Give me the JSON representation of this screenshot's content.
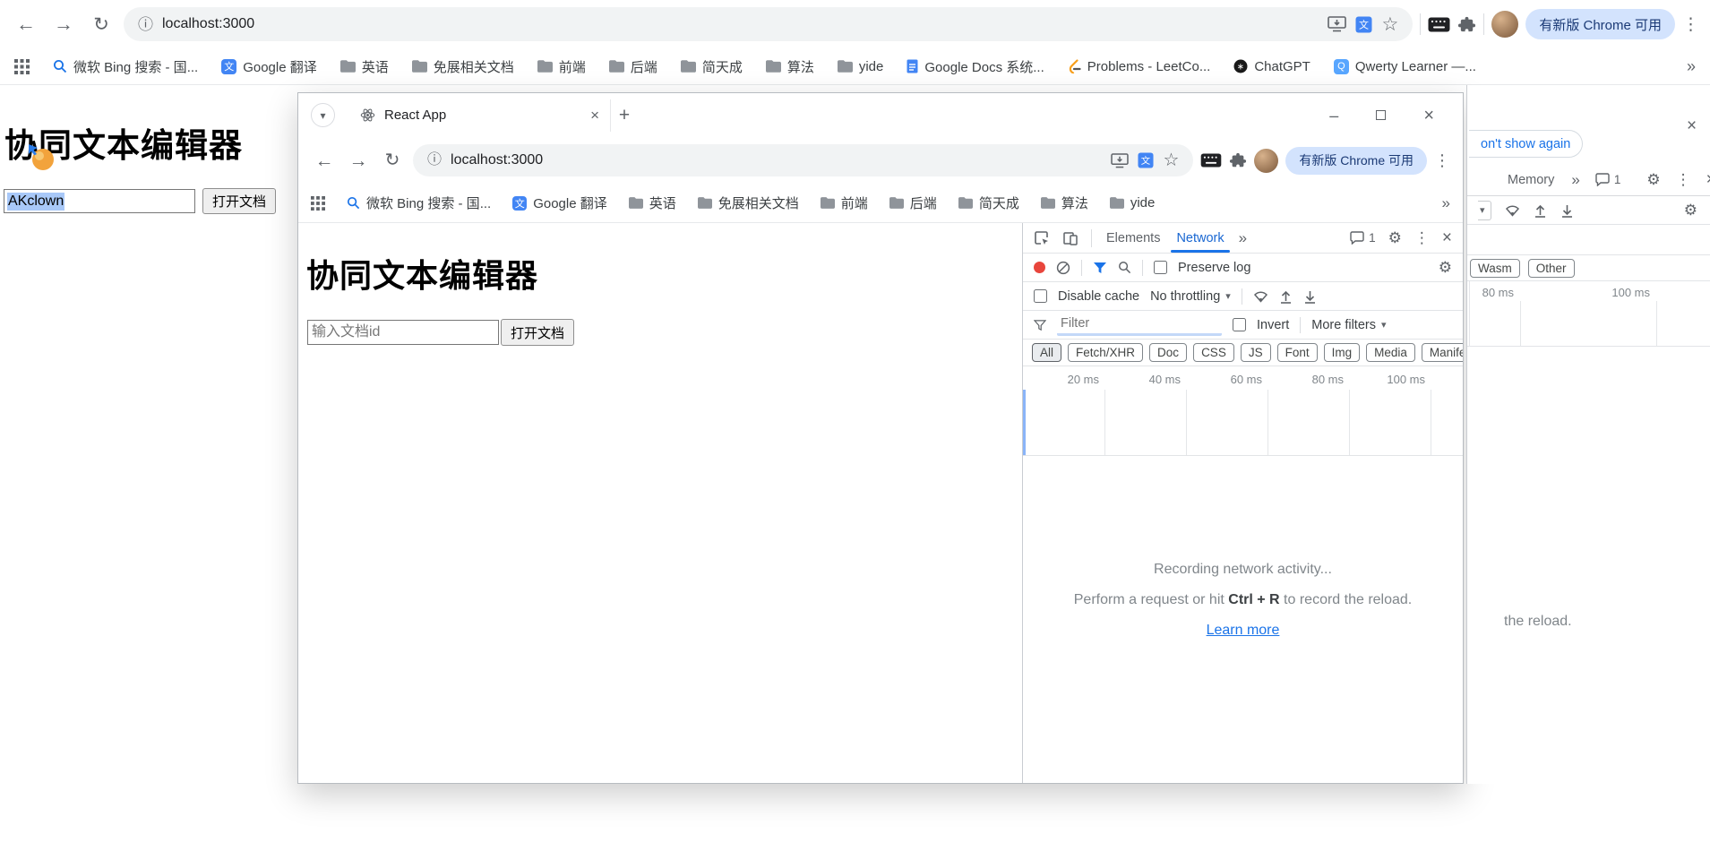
{
  "outer": {
    "toolbar": {
      "url": "localhost:3000",
      "update_label": "有新版 Chrome 可用"
    },
    "bookmarks": [
      "微软 Bing 搜索 - 国...",
      "Google 翻译",
      "英语",
      "免展相关文档",
      "前端",
      "后端",
      "简天成",
      "算法",
      "yide",
      "Google Docs 系统...",
      "Problems - LeetCo...",
      "ChatGPT",
      "Qwerty Learner —..."
    ],
    "page": {
      "title": "协同文本编辑器",
      "doc_input_value": "AKclown",
      "open_doc_button": "打开文档"
    }
  },
  "inner": {
    "titlebar": {
      "tab_title": "React App"
    },
    "toolbar": {
      "url": "localhost:3000",
      "update_label": "有新版 Chrome 可用"
    },
    "bookmarks": [
      "微软 Bing 搜索 - 国...",
      "Google 翻译",
      "英语",
      "免展相关文档",
      "前端",
      "后端",
      "简天成",
      "算法",
      "yide"
    ],
    "page": {
      "title": "协同文本编辑器",
      "doc_input_placeholder": "输入文档id",
      "open_doc_button": "打开文档"
    },
    "devtools": {
      "tab_elements": "Elements",
      "tab_network": "Network",
      "console_count": "1",
      "preserve_log": "Preserve log",
      "disable_cache": "Disable cache",
      "throttling": "No throttling",
      "filter_placeholder": "Filter",
      "invert_label": "Invert",
      "more_filters": "More filters",
      "chips": [
        "All",
        "Fetch/XHR",
        "Doc",
        "CSS",
        "JS",
        "Font",
        "Img",
        "Media",
        "Manifest"
      ],
      "ticks": [
        "20 ms",
        "40 ms",
        "60 ms",
        "80 ms",
        "100 ms"
      ],
      "empty": {
        "title": "Recording network activity...",
        "hint_pre": "Perform a request or hit ",
        "hint_key": "Ctrl + R",
        "hint_post": " to record the reload.",
        "learn_more": "Learn more"
      }
    }
  },
  "right_fragment": {
    "dont_show": "on't show again",
    "tab_memory": "Memory",
    "console_count": "1",
    "chips": [
      "Wasm",
      "Other"
    ],
    "ticks": [
      "80 ms",
      "100 ms"
    ],
    "reload_text": "the reload."
  },
  "colors": {
    "accent_blue": "#1a73e8",
    "active_tab_blue": "#1967d2",
    "selection_blue": "#a8c8f8",
    "record_red": "#e8453c",
    "update_pill_bg": "#d3e3fd"
  }
}
